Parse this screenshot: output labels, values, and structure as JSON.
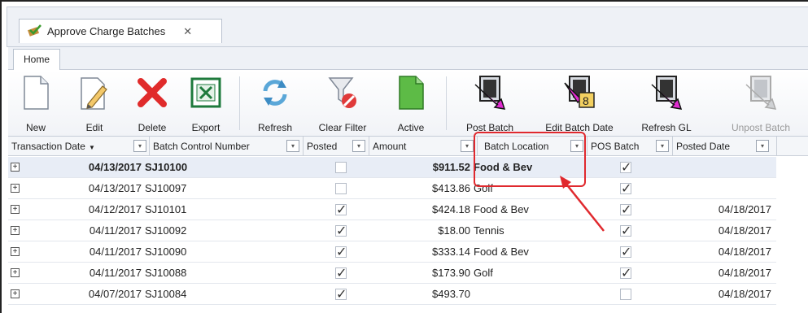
{
  "document_tab": {
    "title": "Approve Charge Batches",
    "close": "✕"
  },
  "ribbon_tab": {
    "label": "Home"
  },
  "ribbon": {
    "buttons": [
      {
        "label": "New",
        "icon": "new-document-icon"
      },
      {
        "label": "Edit",
        "icon": "edit-pencil-icon"
      },
      {
        "label": "Delete",
        "icon": "delete-x-icon"
      },
      {
        "label": "Export",
        "icon": "excel-export-icon"
      },
      {
        "label": "Refresh",
        "icon": "refresh-arrows-icon"
      },
      {
        "label": "Clear Filter",
        "icon": "clear-filter-funnel-icon"
      },
      {
        "label": "Active",
        "icon": "active-document-icon"
      },
      {
        "label": "Post Batch",
        "icon": "post-batch-arrow-icon"
      },
      {
        "label": "Edit Batch Date",
        "icon": "edit-batch-date-icon"
      },
      {
        "label": "Refresh GL",
        "icon": "refresh-gl-icon"
      },
      {
        "label": "Unpost Batch",
        "icon": "unpost-batch-icon",
        "disabled": true
      }
    ]
  },
  "grid": {
    "columns": [
      "Transaction Date",
      "Batch Control Number",
      "Posted",
      "Amount",
      "Batch Location",
      "POS Batch",
      "Posted Date"
    ],
    "rows": [
      {
        "date": "04/13/2017",
        "batch": "SJ10100",
        "posted": false,
        "amount": "$911.52",
        "location": "Food & Bev",
        "pos": true,
        "posted_date": ""
      },
      {
        "date": "04/13/2017",
        "batch": "SJ10097",
        "posted": false,
        "amount": "$413.86",
        "location": "Golf",
        "pos": true,
        "posted_date": ""
      },
      {
        "date": "04/12/2017",
        "batch": "SJ10101",
        "posted": true,
        "amount": "$424.18",
        "location": "Food & Bev",
        "pos": true,
        "posted_date": "04/18/2017"
      },
      {
        "date": "04/11/2017",
        "batch": "SJ10092",
        "posted": true,
        "amount": "$18.00",
        "location": "Tennis",
        "pos": true,
        "posted_date": "04/18/2017"
      },
      {
        "date": "04/11/2017",
        "batch": "SJ10090",
        "posted": true,
        "amount": "$333.14",
        "location": "Food & Bev",
        "pos": true,
        "posted_date": "04/18/2017"
      },
      {
        "date": "04/11/2017",
        "batch": "SJ10088",
        "posted": true,
        "amount": "$173.90",
        "location": "Golf",
        "pos": true,
        "posted_date": "04/18/2017"
      },
      {
        "date": "04/07/2017",
        "batch": "SJ10084",
        "posted": true,
        "amount": "$493.70",
        "location": "",
        "pos": false,
        "posted_date": "04/18/2017"
      }
    ]
  },
  "colors": {
    "annotation": "#e0292e",
    "selected_row": "#e8edf6",
    "delete": "#e02b2b",
    "magenta": "#e02ad0"
  }
}
